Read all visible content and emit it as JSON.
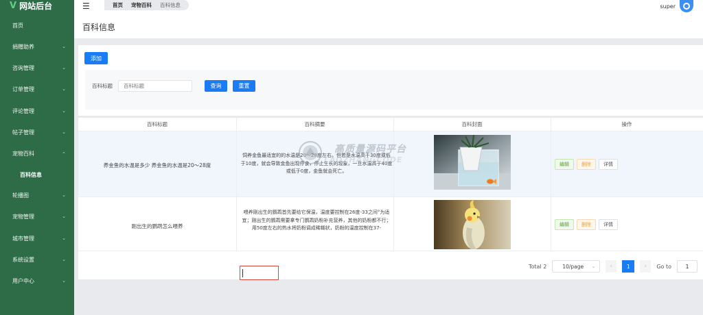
{
  "app": {
    "logo_mark": "V",
    "title": "网站后台"
  },
  "sidebar": {
    "items": [
      {
        "label": "首页",
        "has_chevron": false
      },
      {
        "label": "捐赠助养",
        "has_chevron": true
      },
      {
        "label": "咨询管理",
        "has_chevron": true
      },
      {
        "label": "订单管理",
        "has_chevron": true
      },
      {
        "label": "评论管理",
        "has_chevron": true
      },
      {
        "label": "帖子管理",
        "has_chevron": true
      },
      {
        "label": "宠物百科",
        "has_chevron": true,
        "expanded": true
      },
      {
        "label": "百科信息",
        "sub": true,
        "active": true
      },
      {
        "label": "轮播图",
        "has_chevron": true
      },
      {
        "label": "宠物管理",
        "has_chevron": true
      },
      {
        "label": "城市管理",
        "has_chevron": true
      },
      {
        "label": "系统设置",
        "has_chevron": true
      },
      {
        "label": "用户中心",
        "has_chevron": true
      }
    ],
    "chevron": "⌄"
  },
  "topbar": {
    "menu_icon": "☰",
    "breadcrumbs": [
      "首页",
      "宠物百科",
      "百科信息"
    ],
    "username": "super"
  },
  "page": {
    "title": "百科信息"
  },
  "filter": {
    "add_label": "添加",
    "field_label": "百科标题",
    "field_placeholder": "百科标题",
    "query_label": "查询",
    "reset_label": "重置"
  },
  "table": {
    "headers": [
      "百科标题",
      "百科摘要",
      "百科封面",
      "操作"
    ],
    "rows": [
      {
        "title": "养金鱼的水温是多少 养金鱼的水温是20～28度",
        "summary": "饲养金鱼最适宜的的水温是20～28度左右。但若是水温高于30度或低于10度，就会导致金鱼出现停食，停止生长的现象，一旦水温高于40度或低于0度，金鱼就会死亡。",
        "cover": "goldfish-tank-image"
      },
      {
        "title": "刚出生的鹦鹉怎么喂养",
        "summary": "喂养刚出生的鹦鹉首先要给它保温，温度要控制在26度-33之间°为适宜；刚出生的鹦鹉需要拿专门鹦鹉奶粉补充营养，其他的奶粉都不行；用50度左右的热水将奶粉调成稀糊状，奶粉的温度控制在37-",
        "cover": "cockatiel-image"
      }
    ],
    "ops": {
      "edit": "编辑",
      "delete": "删除",
      "detail": "详情"
    }
  },
  "pagination": {
    "total_label": "Total 2",
    "page_size": "10/page",
    "prev": "‹",
    "current": "1",
    "next": "›",
    "goto_label": "Go to",
    "goto_value": "1"
  },
  "watermark": {
    "text": "高质量源码平台",
    "sub": "LAOZHANGCODE"
  }
}
